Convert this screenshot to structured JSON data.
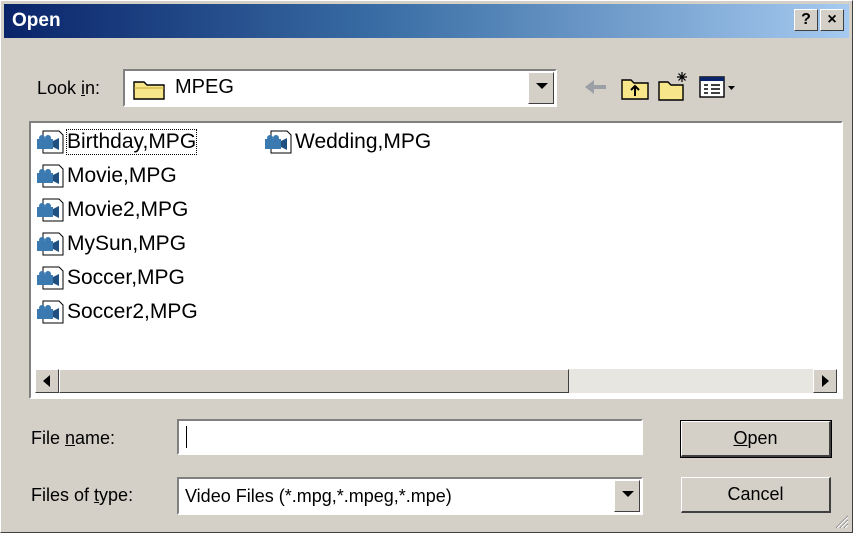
{
  "window": {
    "title": "Open",
    "help_label": "?",
    "close_label": "×"
  },
  "lookin": {
    "label_pre": "Look ",
    "label_key": "i",
    "label_post": "n:",
    "value": "MPEG",
    "icon": "folder-icon"
  },
  "toolbar": {
    "back_icon": "back-arrow-icon",
    "up_icon": "up-folder-icon",
    "new_folder_icon": "new-folder-icon",
    "view_icon": "view-menu-icon"
  },
  "files": [
    {
      "name": "Birthday,MPG",
      "icon": "video-file-icon"
    },
    {
      "name": "Movie,MPG",
      "icon": "video-file-icon"
    },
    {
      "name": "Movie2,MPG",
      "icon": "video-file-icon"
    },
    {
      "name": "MySun,MPG",
      "icon": "video-file-icon"
    },
    {
      "name": "Soccer,MPG",
      "icon": "video-file-icon"
    },
    {
      "name": "Soccer2,MPG",
      "icon": "video-file-icon"
    },
    {
      "name": "Wedding,MPG",
      "icon": "video-file-icon"
    }
  ],
  "filename": {
    "label_pre": "File ",
    "label_key": "n",
    "label_post": "ame:",
    "value": ""
  },
  "filetype": {
    "label_pre": "Files of ",
    "label_key": "t",
    "label_post": "ype:",
    "value": "Video Files (*.mpg,*.mpeg,*.mpe)"
  },
  "buttons": {
    "open_key": "O",
    "open_rest": "pen",
    "cancel": "Cancel"
  },
  "colors": {
    "title_start": "#0a246a",
    "title_end": "#a6caf0",
    "face": "#d4d0c8"
  }
}
